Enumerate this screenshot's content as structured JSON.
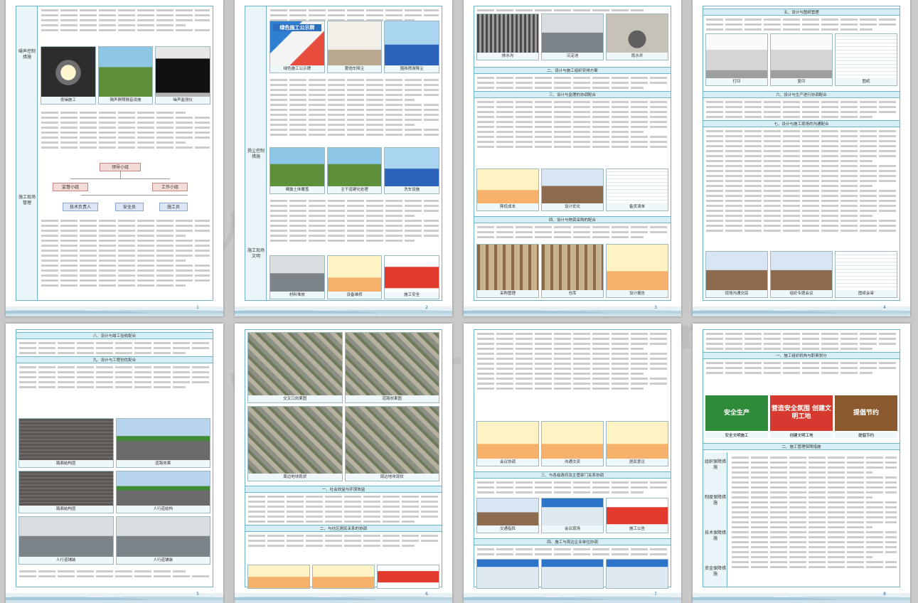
{
  "watermark": {
    "primary": "人人文库",
    "secondary": "www.bing-zywu.com"
  },
  "colors": {
    "border": "#6fb3c9",
    "header_fill": "#d6eef5",
    "page_bg": "#c9c9c9"
  },
  "pages": [
    {
      "side_labels": [
        "噪声控制措施",
        "",
        "施工现场管理"
      ],
      "photos_top": [
        "低噪施工",
        "隔声屏障隔音设施",
        "噪声监测仪"
      ],
      "diagram": {
        "root": "领导小组",
        "left": "监督小组",
        "right": "工作小组",
        "leaves": [
          "技术负责人",
          "安全员",
          "施工员"
        ]
      },
      "number": "1"
    },
    {
      "side_labels": [
        "扬尘控制措施",
        "施工现场文明"
      ],
      "board_title": "绿色施工公示牌",
      "photos_top": [
        "绿色施工公示牌",
        "雾炮车降尘",
        "围挡喷淋降尘"
      ],
      "photos_mid": [
        "裸露土体覆盖",
        "主干道硬化处理",
        "洗车设施"
      ],
      "chart_title": "降低成本",
      "photos_bottom": [
        "材料堆放",
        "设备维修",
        "施工安全"
      ],
      "number": "2"
    },
    {
      "photos_top": [
        "排水沟",
        "沉淀池",
        "雨水井"
      ],
      "sections": [
        "二、设计与施工组织安排方案",
        "三、设计与监理的协调配合",
        "四、设计与物资采购的配合"
      ],
      "photos_mid": [
        "降低成本",
        "设计优化",
        "备货清单"
      ],
      "photos_bottom": [
        "采购管理",
        "仓库",
        "设计报告"
      ],
      "number": "3"
    },
    {
      "sections": [
        "五、设计与图纸管理",
        "六、设计与生产进行协调配合",
        "七、设计与施工现场的沟通配合"
      ],
      "photos_top": [
        "打印",
        "复印",
        "图纸"
      ],
      "photos_bottom": [
        "现场沟通交底",
        "组织专题会议",
        "图纸会审"
      ],
      "number": "4"
    },
    {
      "sections": [
        "八、设计与竣工验收配合",
        "九、设计与工程创优配合"
      ],
      "photos": [
        "路面结构层",
        "道路效果",
        "路面结构层",
        "人行道结构",
        "人行道铺装",
        "人行道铺装"
      ],
      "number": "5"
    },
    {
      "photos": [
        "交叉口效果图",
        "道路效果图",
        "周边地块现状",
        "周边地块现状"
      ],
      "sections": [
        "一、社会效益与环境效益",
        "二、与社区居民关系的协调"
      ],
      "number": "6"
    },
    {
      "sections": [
        "三、与各级政府及主管部门关系协调",
        "四、施工与周边企业单位协调"
      ],
      "photos": [
        "会议协调",
        "沟通交流",
        "居民意见",
        "交通指挥",
        "会议现场",
        "施工公告"
      ],
      "number": "7"
    },
    {
      "stamps": [
        "安全生产",
        "营造安全氛围 创建文明工地",
        "提倡节约"
      ],
      "captions": [
        "安全文明施工",
        "创建文明工地",
        "提倡节约"
      ],
      "sections": [
        "一、施工组织机构与职责划分",
        "二、施工管理保障措施"
      ],
      "side_labels": [
        "组织保障措施",
        "制度保障措施",
        "技术保障措施",
        "资金保障措施"
      ],
      "number": "8"
    }
  ]
}
